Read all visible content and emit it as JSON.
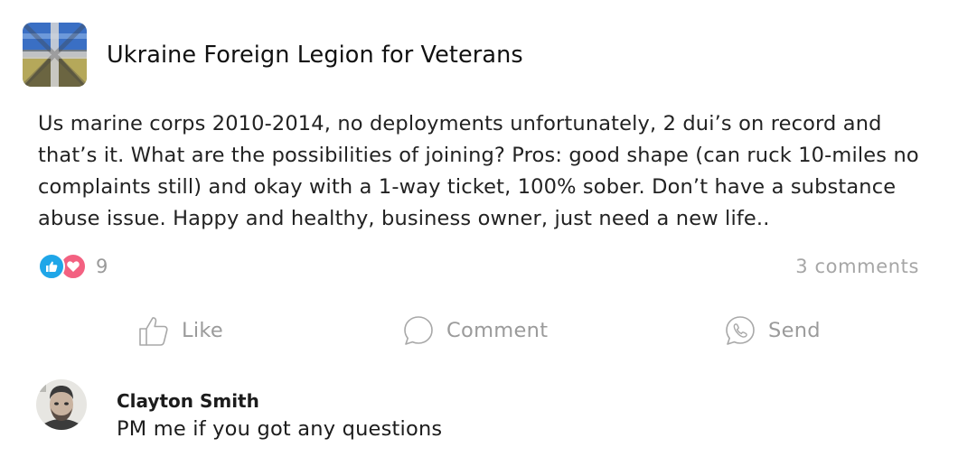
{
  "group": {
    "name": "Ukraine Foreign Legion for Veterans",
    "avatar_icon": "group-avatar-flag"
  },
  "post": {
    "body": "Us marine corps 2010-2014, no deployments unfortunately, 2 dui’s on record and that’s it. What are the possibilities of joining? Pros: good shape (can ruck 10-miles no complaints still) and okay with a 1-way ticket, 100% sober. Don’t have a substance abuse issue. Happy and healthy, business owner, just need a new life.."
  },
  "engagement": {
    "reactions": [
      {
        "icon": "like-reaction-icon",
        "color": "#1fa6e8"
      },
      {
        "icon": "love-reaction-icon",
        "color": "#f36181"
      }
    ],
    "reaction_count": "9",
    "comments_label": "3 comments"
  },
  "actions": {
    "like_label": "Like",
    "comment_label": "Comment",
    "send_label": "Send"
  },
  "comments": [
    {
      "author": "Clayton Smith",
      "text": "PM me if you got any questions",
      "avatar_icon": "commenter-avatar"
    }
  ],
  "colors": {
    "muted_text": "#9b9b9b",
    "body_text": "#222222"
  }
}
